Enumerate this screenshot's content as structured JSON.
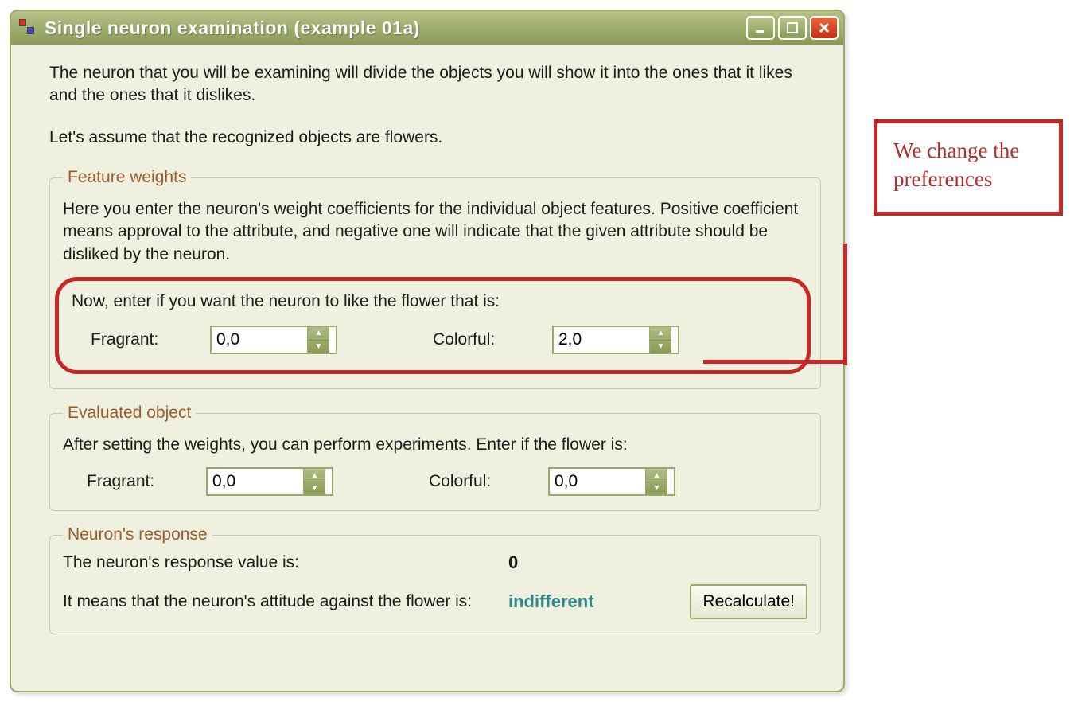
{
  "window": {
    "title": "Single neuron examination (example 01a)"
  },
  "intro": {
    "p1": "The neuron that you will be examining will divide the objects you will show it into the ones that it likes and the ones that it dislikes.",
    "p2": "Let's assume that the recognized objects are flowers."
  },
  "weights": {
    "legend": "Feature weights",
    "desc": "Here you enter the neuron's weight coefficients for the individual object features. Positive coefficient means approval to the attribute, and negative one will indicate that the given attribute should be disliked by the neuron.",
    "prompt": "Now, enter if you want the neuron to like the flower that is:",
    "fragrant_label": "Fragrant:",
    "fragrant_value": "0,0",
    "colorful_label": "Colorful:",
    "colorful_value": "2,0"
  },
  "evaluated": {
    "legend": "Evaluated object",
    "desc": "After setting the weights, you can perform experiments. Enter if the flower is:",
    "fragrant_label": "Fragrant:",
    "fragrant_value": "0,0",
    "colorful_label": "Colorful:",
    "colorful_value": "0,0"
  },
  "response": {
    "legend": "Neuron's response",
    "line1": "The neuron's response value is:",
    "value": "0",
    "line2": "It means that the neuron's attitude against the flower is:",
    "attitude": "indifferent",
    "button": "Recalculate!"
  },
  "callout": {
    "text": "We change the preferences"
  }
}
